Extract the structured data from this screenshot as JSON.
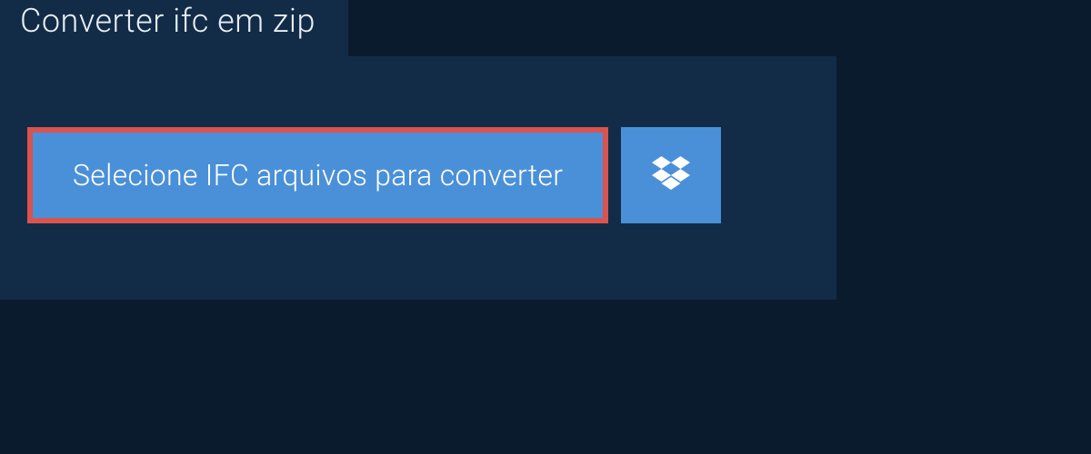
{
  "tab": {
    "title": "Converter ifc em zip"
  },
  "actions": {
    "select_files_label": "Selecione IFC arquivos para converter"
  }
}
